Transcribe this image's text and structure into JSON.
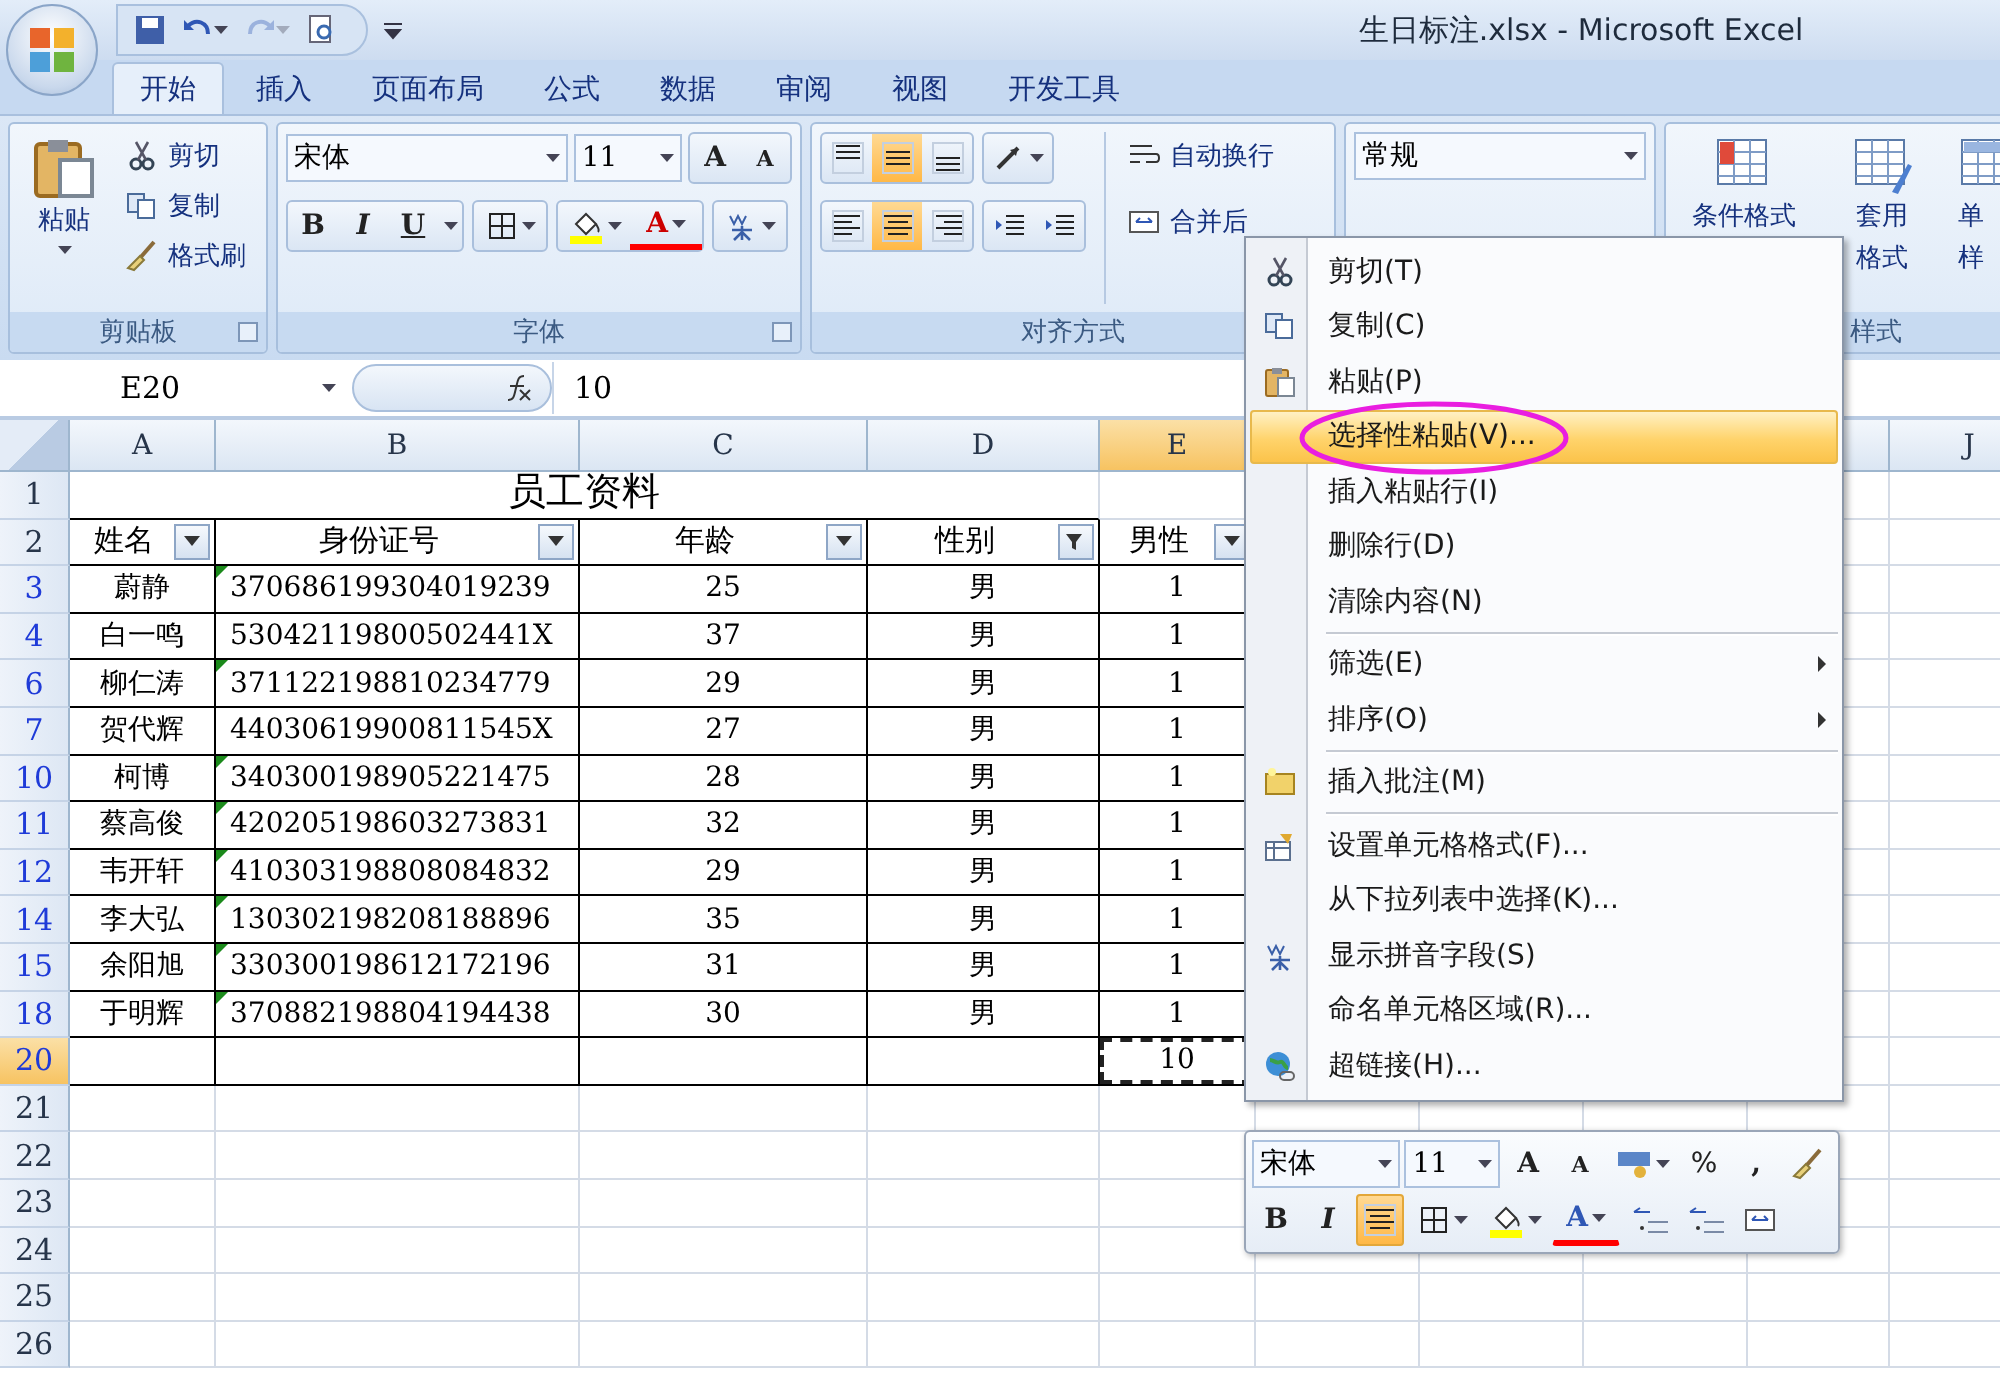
{
  "window": {
    "title": "生日标注.xlsx - Microsoft Excel"
  },
  "quick_access": {
    "redo_enabled": false
  },
  "tabs": [
    {
      "label": "开始",
      "selected": true
    },
    {
      "label": "插入",
      "selected": false
    },
    {
      "label": "页面布局",
      "selected": false
    },
    {
      "label": "公式",
      "selected": false
    },
    {
      "label": "数据",
      "selected": false
    },
    {
      "label": "审阅",
      "selected": false
    },
    {
      "label": "视图",
      "selected": false
    },
    {
      "label": "开发工具",
      "selected": false
    }
  ],
  "ribbon": {
    "clipboard": {
      "title": "剪贴板",
      "paste": "粘贴",
      "items": [
        {
          "label": "剪切",
          "kind": "cut"
        },
        {
          "label": "复制",
          "kind": "copy"
        },
        {
          "label": "格式刷",
          "kind": "brush"
        }
      ]
    },
    "font": {
      "title": "字体",
      "font_name": "宋体",
      "font_size": "11",
      "grow": "A",
      "shrink": "A",
      "bold": "B",
      "italic": "I",
      "underline": "U",
      "font_color": "A"
    },
    "alignment": {
      "title": "对齐方式",
      "vertical": [
        {
          "kind": "top",
          "selected": false
        },
        {
          "kind": "middle",
          "selected": true
        },
        {
          "kind": "bottom",
          "selected": false
        }
      ],
      "horizontal": [
        {
          "kind": "left",
          "selected": false
        },
        {
          "kind": "center",
          "selected": true
        },
        {
          "kind": "right",
          "selected": false
        }
      ],
      "wrap": "自动换行",
      "merge": "合并后"
    },
    "number": {
      "format": "常规"
    },
    "styles": {
      "title": "样式",
      "buttons": [
        {
          "kind": "conditional",
          "lines": [
            "条件格式"
          ]
        },
        {
          "kind": "table",
          "lines": [
            "套用",
            "格式"
          ]
        },
        {
          "kind": "cell",
          "lines": [
            "单",
            "样"
          ]
        }
      ]
    }
  },
  "formula_bar": {
    "name_box": "E20",
    "value": "10"
  },
  "columns": [
    {
      "label": "A",
      "selected": false
    },
    {
      "label": "B",
      "selected": false
    },
    {
      "label": "C",
      "selected": false
    },
    {
      "label": "D",
      "selected": false
    },
    {
      "label": "E",
      "selected": true
    },
    {
      "label": "J",
      "selected": false
    }
  ],
  "rows": [
    {
      "header": "1",
      "selected": false,
      "filter_match": false,
      "kind": "title",
      "text": "员工资料"
    },
    {
      "header": "2",
      "selected": false,
      "filter_match": false,
      "kind": "header",
      "cells": [
        {
          "text": "姓名",
          "filtered": false
        },
        {
          "text": "身份证号",
          "filtered": false
        },
        {
          "text": "年龄",
          "filtered": false
        },
        {
          "text": "性别",
          "filtered": true
        },
        {
          "text": "男性",
          "filtered": false
        }
      ]
    },
    {
      "header": "3",
      "selected": false,
      "filter_match": true,
      "kind": "data",
      "flag": true,
      "cells": [
        "蔚静",
        "370686199304019239",
        "25",
        "男",
        "1"
      ]
    },
    {
      "header": "4",
      "selected": false,
      "filter_match": true,
      "kind": "data",
      "flag": false,
      "cells": [
        "白一鸣",
        "53042119800502441X",
        "37",
        "男",
        "1"
      ]
    },
    {
      "header": "6",
      "selected": false,
      "filter_match": true,
      "kind": "data",
      "flag": true,
      "cells": [
        "柳仁涛",
        "371122198810234779",
        "29",
        "男",
        "1"
      ]
    },
    {
      "header": "7",
      "selected": false,
      "filter_match": true,
      "kind": "data",
      "flag": false,
      "cells": [
        "贺代辉",
        "44030619900811545X",
        "27",
        "男",
        "1"
      ]
    },
    {
      "header": "10",
      "selected": false,
      "filter_match": true,
      "kind": "data",
      "flag": true,
      "cells": [
        "柯博",
        "340300198905221475",
        "28",
        "男",
        "1"
      ]
    },
    {
      "header": "11",
      "selected": false,
      "filter_match": true,
      "kind": "data",
      "flag": true,
      "cells": [
        "蔡高俊",
        "420205198603273831",
        "32",
        "男",
        "1"
      ]
    },
    {
      "header": "12",
      "selected": false,
      "filter_match": true,
      "kind": "data",
      "flag": true,
      "cells": [
        "韦开轩",
        "410303198808084832",
        "29",
        "男",
        "1"
      ]
    },
    {
      "header": "14",
      "selected": false,
      "filter_match": true,
      "kind": "data",
      "flag": true,
      "cells": [
        "李大弘",
        "130302198208188896",
        "35",
        "男",
        "1"
      ]
    },
    {
      "header": "15",
      "selected": false,
      "filter_match": true,
      "kind": "data",
      "flag": true,
      "cells": [
        "余阳旭",
        "330300198612172196",
        "31",
        "男",
        "1"
      ]
    },
    {
      "header": "18",
      "selected": false,
      "filter_match": true,
      "kind": "data",
      "flag": true,
      "cells": [
        "于明辉",
        "370882198804194438",
        "30",
        "男",
        "1"
      ]
    },
    {
      "header": "20",
      "selected": true,
      "filter_match": true,
      "kind": "total",
      "value": "10",
      "copied": true
    },
    {
      "header": "21",
      "selected": false,
      "filter_match": false,
      "kind": "empty"
    },
    {
      "header": "22",
      "selected": false,
      "filter_match": false,
      "kind": "empty"
    },
    {
      "header": "23",
      "selected": false,
      "filter_match": false,
      "kind": "empty"
    },
    {
      "header": "24",
      "selected": false,
      "filter_match": false,
      "kind": "empty"
    },
    {
      "header": "25",
      "selected": false,
      "filter_match": false,
      "kind": "empty"
    },
    {
      "header": "26",
      "selected": false,
      "filter_match": false,
      "kind": "empty"
    }
  ],
  "context_menu": {
    "items": [
      {
        "label": "剪切(T)",
        "kind": "cut",
        "selected": false,
        "circled": false,
        "submenu": false,
        "separator_before": false
      },
      {
        "label": "复制(C)",
        "kind": "copy",
        "selected": false,
        "circled": false,
        "submenu": false,
        "separator_before": false
      },
      {
        "label": "粘贴(P)",
        "kind": "paste",
        "selected": false,
        "circled": false,
        "submenu": false,
        "separator_before": false
      },
      {
        "label": "选择性粘贴(V)...",
        "kind": "none",
        "selected": true,
        "circled": true,
        "submenu": false,
        "separator_before": false
      },
      {
        "label": "插入粘贴行(I)",
        "kind": "none",
        "selected": false,
        "circled": false,
        "submenu": false,
        "separator_before": false
      },
      {
        "label": "删除行(D)",
        "kind": "none",
        "selected": false,
        "circled": false,
        "submenu": false,
        "separator_before": false
      },
      {
        "label": "清除内容(N)",
        "kind": "none",
        "selected": false,
        "circled": false,
        "submenu": false,
        "separator_before": false
      },
      {
        "label": "筛选(E)",
        "kind": "none",
        "selected": false,
        "circled": false,
        "submenu": true,
        "separator_before": true
      },
      {
        "label": "排序(O)",
        "kind": "none",
        "selected": false,
        "circled": false,
        "submenu": true,
        "separator_before": false
      },
      {
        "label": "插入批注(M)",
        "kind": "comment",
        "selected": false,
        "circled": false,
        "submenu": false,
        "separator_before": true
      },
      {
        "label": "设置单元格格式(F)...",
        "kind": "format",
        "selected": false,
        "circled": false,
        "submenu": false,
        "separator_before": true
      },
      {
        "label": "从下拉列表中选择(K)...",
        "kind": "none",
        "selected": false,
        "circled": false,
        "submenu": false,
        "separator_before": false
      },
      {
        "label": "显示拼音字段(S)",
        "kind": "phonetic",
        "selected": false,
        "circled": false,
        "submenu": false,
        "separator_before": false
      },
      {
        "label": "命名单元格区域(R)...",
        "kind": "none",
        "selected": false,
        "circled": false,
        "submenu": false,
        "separator_before": false
      },
      {
        "label": "超链接(H)...",
        "kind": "link",
        "selected": false,
        "circled": false,
        "submenu": false,
        "separator_before": false
      }
    ]
  },
  "mini_toolbar": {
    "font_name": "宋体",
    "font_size": "11",
    "grow": "A",
    "shrink": "A",
    "percent": "%",
    "comma": ",",
    "bold": "B",
    "italic": "I",
    "font_color": "A",
    "center_selected": true
  }
}
